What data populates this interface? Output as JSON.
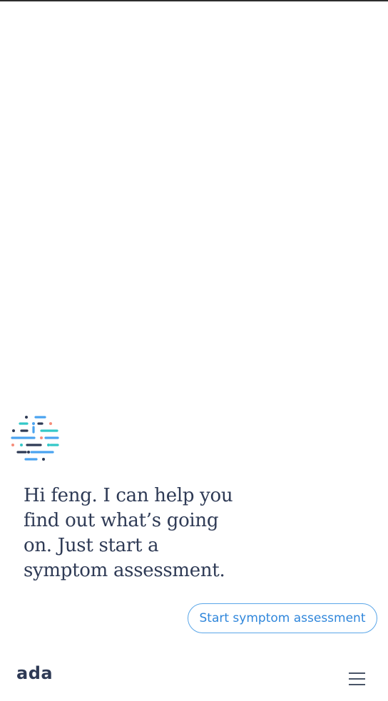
{
  "chat": {
    "message": "Hi feng. I can help you find out what’s going on. Just start a symptom assessment."
  },
  "actions": {
    "start_label": "Start symptom assessment"
  },
  "footer": {
    "logo_text": "ada",
    "menu_icon": "hamburger-menu-icon"
  },
  "colors": {
    "text": "#2e3a55",
    "accent": "#2f86db",
    "teal": "#32c8c8",
    "blue": "#4aa3f0",
    "coral": "#f58d7a",
    "navy": "#2e3a55"
  }
}
